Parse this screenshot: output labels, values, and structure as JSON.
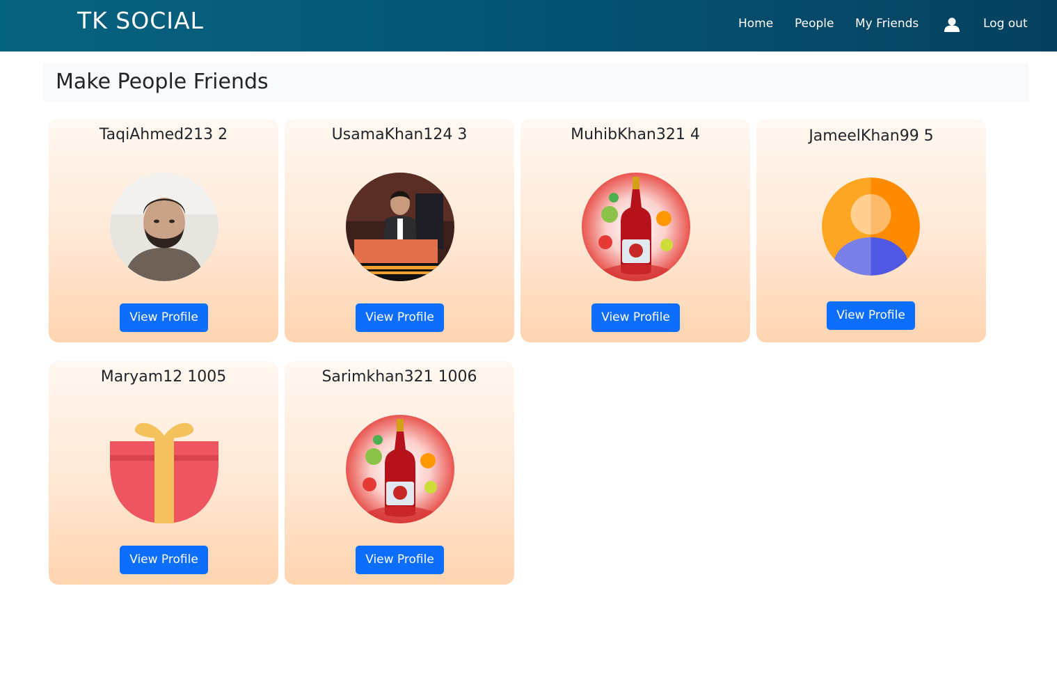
{
  "navbar": {
    "brand": "TK SOCIAL",
    "links": [
      {
        "label": "Home"
      },
      {
        "label": "People"
      },
      {
        "label": "My Friends"
      },
      {
        "label": "Log out"
      }
    ],
    "user_icon": "user-icon"
  },
  "page": {
    "heading": "Make People Friends"
  },
  "people": [
    {
      "name": "TaqiAhmed213 2",
      "button": "View Profile",
      "avatar": "man-photo"
    },
    {
      "name": "UsamaKhan124 3",
      "button": "View Profile",
      "avatar": "speaker-photo"
    },
    {
      "name": "MuhibKhan321 4",
      "button": "View Profile",
      "avatar": "bottle-photo"
    },
    {
      "name": "JameelKhan99 5",
      "button": "View Profile",
      "avatar": "default-avatar"
    },
    {
      "name": "Maryam12 1005",
      "button": "View Profile",
      "avatar": "gift-icon"
    },
    {
      "name": "Sarimkhan321 1006",
      "button": "View Profile",
      "avatar": "bottle-photo"
    }
  ],
  "colors": {
    "navbar": "#055677",
    "button": "#0d6efd",
    "heading_bg": "#f8f9fa"
  }
}
